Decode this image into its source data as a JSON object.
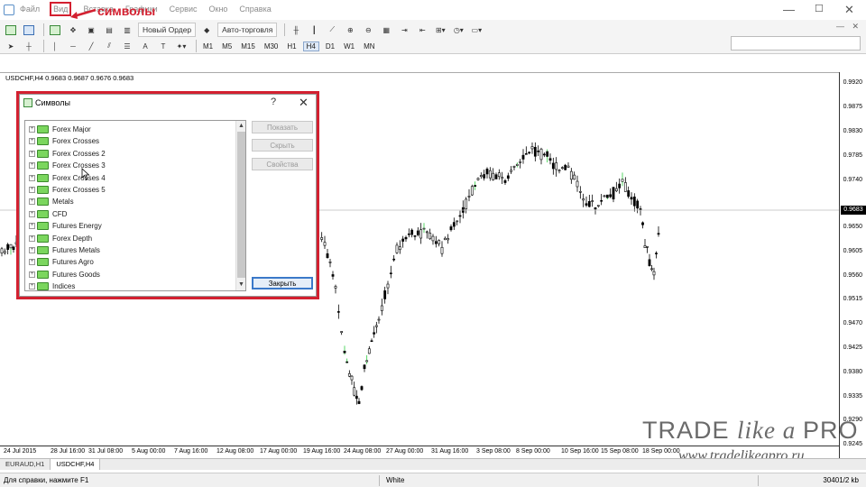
{
  "menu": {
    "items": [
      "Файл",
      "Вид",
      "Вставка",
      "Графики",
      "Сервис",
      "Окно",
      "Справка"
    ],
    "highlighted": "Вид"
  },
  "annotation": {
    "text": "символы",
    "color": "#d32030"
  },
  "window_controls": {
    "minimize": "—",
    "maximize": "☐",
    "close": "✕"
  },
  "toolbar": {
    "new_order": "Новый Ордер",
    "autotrade": "Авто-торговля",
    "timeframes": [
      "M1",
      "M5",
      "M15",
      "M30",
      "H1",
      "H4",
      "D1",
      "W1",
      "MN"
    ],
    "selected_timeframe": "H4",
    "inner_min": "—",
    "inner_close": "✕"
  },
  "chart": {
    "info": "USDCHF,H4  0.9683 0.9687 0.9676 0.9683",
    "current_price": "0.9683",
    "price_labels": [
      "0.9920",
      "0.9875",
      "0.9830",
      "0.9785",
      "0.9740",
      "0.9650",
      "0.9605",
      "0.9560",
      "0.9515",
      "0.9470",
      "0.9425",
      "0.9380",
      "0.9335",
      "0.9290",
      "0.9245"
    ],
    "time_labels": [
      "24 Jul 2015",
      "28 Jul 16:00",
      "31 Jul 08:00",
      "5 Aug 00:00",
      "7 Aug 16:00",
      "12 Aug 08:00",
      "17 Aug 00:00",
      "19 Aug 16:00",
      "24 Aug 08:00",
      "27 Aug 00:00",
      "31 Aug 16:00",
      "3 Sep 08:00",
      "8 Sep 00:00",
      "10 Sep 16:00",
      "15 Sep 08:00",
      "18 Sep 00:00"
    ]
  },
  "dialog": {
    "title": "Символы",
    "help": "?",
    "close": "✕",
    "items": [
      "Forex Major",
      "Forex Crosses",
      "Forex Crosses 2",
      "Forex Crosses 3",
      "Forex Crosses 4",
      "Forex Crosses 5",
      "Metals",
      "CFD",
      "Futures Energy",
      "Forex Depth",
      "Futures Metals",
      "Futures Agro",
      "Futures Goods",
      "Indices"
    ],
    "buttons": {
      "show": "Показать",
      "hide": "Скрыть",
      "properties": "Свойства",
      "close": "Закрыть"
    }
  },
  "tabs": [
    "EURAUD,H1",
    "USDCHF,H4"
  ],
  "active_tab": "USDCHF,H4",
  "status": {
    "help": "Для справки, нажмите F1",
    "profile": "White",
    "traffic": "30401/2 kb"
  },
  "watermark": {
    "logo_a": "TRADE ",
    "logo_b": "like a ",
    "logo_c": "PRO",
    "url": "www.tradelikeapro.ru"
  },
  "colors": {
    "highlight_red": "#d32030",
    "accent_blue": "#3b79c9",
    "folder_green": "#7bd65e"
  }
}
